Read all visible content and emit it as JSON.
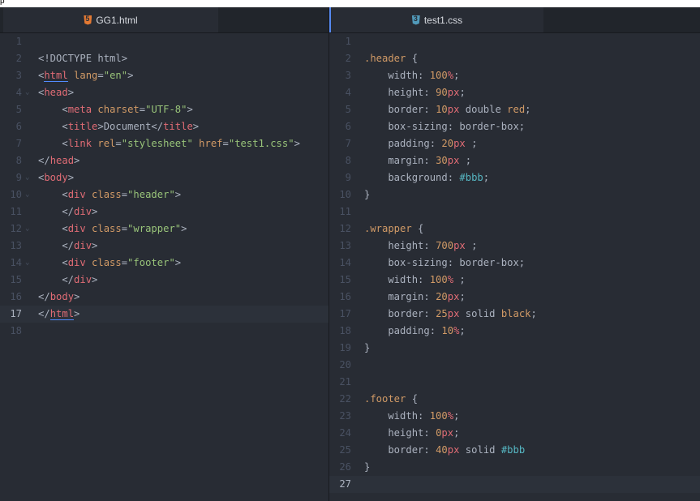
{
  "top_strip": "p",
  "left_tab": {
    "label": "GG1.html",
    "icon": "html5-icon"
  },
  "right_tab": {
    "label": "test1.css",
    "icon": "css3-icon"
  },
  "colors": {
    "background": "#282c34",
    "tab_bar": "#21252b",
    "active_tab_accent": "#568af2",
    "tag": "#e06c75",
    "attribute": "#d19a66",
    "string": "#98c379",
    "number": "#d19a66",
    "unit": "#e06c75",
    "hex": "#56b6c2",
    "line_number": "#495162"
  },
  "html_lines": [
    {
      "n": "1",
      "fold": false,
      "tokens": []
    },
    {
      "n": "2",
      "fold": false,
      "tokens": [
        [
          "punc",
          "<!DOCTYPE html>"
        ]
      ]
    },
    {
      "n": "3",
      "fold": false,
      "tokens": [
        [
          "punc",
          "<"
        ],
        [
          "tag",
          "html"
        ],
        [
          "punc",
          " "
        ],
        [
          "attr",
          "lang"
        ],
        [
          "punc",
          "="
        ],
        [
          "str",
          "\"en\""
        ],
        [
          "punc",
          ">"
        ]
      ]
    },
    {
      "n": "4",
      "fold": true,
      "tokens": [
        [
          "punc",
          "<"
        ],
        [
          "tag",
          "head"
        ],
        [
          "punc",
          ">"
        ]
      ]
    },
    {
      "n": "5",
      "fold": false,
      "tokens": [
        [
          "punc",
          "    <"
        ],
        [
          "tag",
          "meta"
        ],
        [
          "punc",
          " "
        ],
        [
          "attr",
          "charset"
        ],
        [
          "punc",
          "="
        ],
        [
          "str",
          "\"UTF-8\""
        ],
        [
          "punc",
          ">"
        ]
      ]
    },
    {
      "n": "6",
      "fold": false,
      "tokens": [
        [
          "punc",
          "    <"
        ],
        [
          "tag",
          "title"
        ],
        [
          "punc",
          ">Document</"
        ],
        [
          "tag",
          "title"
        ],
        [
          "punc",
          ">"
        ]
      ]
    },
    {
      "n": "7",
      "fold": false,
      "tokens": [
        [
          "punc",
          "    <"
        ],
        [
          "tag",
          "link"
        ],
        [
          "punc",
          " "
        ],
        [
          "attr",
          "rel"
        ],
        [
          "punc",
          "="
        ],
        [
          "str",
          "\"stylesheet\""
        ],
        [
          "punc",
          " "
        ],
        [
          "attr",
          "href"
        ],
        [
          "punc",
          "="
        ],
        [
          "str",
          "\"test1.css\""
        ],
        [
          "punc",
          ">"
        ]
      ]
    },
    {
      "n": "8",
      "fold": false,
      "tokens": [
        [
          "punc",
          "</"
        ],
        [
          "tag",
          "head"
        ],
        [
          "punc",
          ">"
        ]
      ]
    },
    {
      "n": "9",
      "fold": true,
      "tokens": [
        [
          "punc",
          "<"
        ],
        [
          "tag",
          "body"
        ],
        [
          "punc",
          ">"
        ]
      ]
    },
    {
      "n": "10",
      "fold": true,
      "tokens": [
        [
          "punc",
          "    <"
        ],
        [
          "tag",
          "div"
        ],
        [
          "punc",
          " "
        ],
        [
          "attr",
          "class"
        ],
        [
          "punc",
          "="
        ],
        [
          "str",
          "\"header\""
        ],
        [
          "punc",
          ">"
        ]
      ]
    },
    {
      "n": "11",
      "fold": false,
      "tokens": [
        [
          "punc",
          "    </"
        ],
        [
          "tag",
          "div"
        ],
        [
          "punc",
          ">"
        ]
      ]
    },
    {
      "n": "12",
      "fold": true,
      "tokens": [
        [
          "punc",
          "    <"
        ],
        [
          "tag",
          "div"
        ],
        [
          "punc",
          " "
        ],
        [
          "attr",
          "class"
        ],
        [
          "punc",
          "="
        ],
        [
          "str",
          "\"wrapper\""
        ],
        [
          "punc",
          ">"
        ]
      ]
    },
    {
      "n": "13",
      "fold": false,
      "tokens": [
        [
          "punc",
          "    </"
        ],
        [
          "tag",
          "div"
        ],
        [
          "punc",
          ">"
        ]
      ]
    },
    {
      "n": "14",
      "fold": true,
      "tokens": [
        [
          "punc",
          "    <"
        ],
        [
          "tag",
          "div"
        ],
        [
          "punc",
          " "
        ],
        [
          "attr",
          "class"
        ],
        [
          "punc",
          "="
        ],
        [
          "str",
          "\"footer\""
        ],
        [
          "punc",
          ">"
        ]
      ]
    },
    {
      "n": "15",
      "fold": false,
      "tokens": [
        [
          "punc",
          "    </"
        ],
        [
          "tag",
          "div"
        ],
        [
          "punc",
          ">"
        ]
      ]
    },
    {
      "n": "16",
      "fold": false,
      "tokens": [
        [
          "punc",
          "</"
        ],
        [
          "tag",
          "body"
        ],
        [
          "punc",
          ">"
        ]
      ]
    },
    {
      "n": "17",
      "fold": false,
      "cursor": true,
      "tokens": [
        [
          "punc",
          "</"
        ],
        [
          "tag",
          "html"
        ],
        [
          "punc",
          ">"
        ]
      ]
    },
    {
      "n": "18",
      "fold": false,
      "tokens": []
    }
  ],
  "css_lines": [
    {
      "n": "1",
      "tokens": []
    },
    {
      "n": "2",
      "tokens": [
        [
          "sel",
          ".header"
        ],
        [
          "punc",
          " {"
        ]
      ]
    },
    {
      "n": "3",
      "tokens": [
        [
          "prop",
          "    width: "
        ],
        [
          "num",
          "100"
        ],
        [
          "unit",
          "%"
        ],
        [
          "punc",
          ";"
        ]
      ]
    },
    {
      "n": "4",
      "tokens": [
        [
          "prop",
          "    height: "
        ],
        [
          "num",
          "90"
        ],
        [
          "unit",
          "px"
        ],
        [
          "punc",
          ";"
        ]
      ]
    },
    {
      "n": "5",
      "tokens": [
        [
          "prop",
          "    border: "
        ],
        [
          "num",
          "10"
        ],
        [
          "unit",
          "px"
        ],
        [
          "kw",
          " double "
        ],
        [
          "red",
          "red"
        ],
        [
          "punc",
          ";"
        ]
      ]
    },
    {
      "n": "6",
      "tokens": [
        [
          "prop",
          "    box-sizing: "
        ],
        [
          "kw",
          "border-box"
        ],
        [
          "punc",
          ";"
        ]
      ]
    },
    {
      "n": "7",
      "tokens": [
        [
          "prop",
          "    padding: "
        ],
        [
          "num",
          "20"
        ],
        [
          "unit",
          "px"
        ],
        [
          "punc",
          " ;"
        ]
      ]
    },
    {
      "n": "8",
      "tokens": [
        [
          "prop",
          "    margin: "
        ],
        [
          "num",
          "30"
        ],
        [
          "unit",
          "px"
        ],
        [
          "punc",
          " ;"
        ]
      ]
    },
    {
      "n": "9",
      "tokens": [
        [
          "prop",
          "    background: "
        ],
        [
          "hash",
          "#bbb"
        ],
        [
          "punc",
          ";"
        ]
      ]
    },
    {
      "n": "10",
      "tokens": [
        [
          "punc",
          "}"
        ]
      ]
    },
    {
      "n": "11",
      "tokens": []
    },
    {
      "n": "12",
      "tokens": [
        [
          "sel",
          ".wrapper"
        ],
        [
          "punc",
          " {"
        ]
      ]
    },
    {
      "n": "13",
      "tokens": [
        [
          "prop",
          "    height: "
        ],
        [
          "num",
          "700"
        ],
        [
          "unit",
          "px"
        ],
        [
          "punc",
          " ;"
        ]
      ]
    },
    {
      "n": "14",
      "tokens": [
        [
          "prop",
          "    box-sizing: "
        ],
        [
          "kw",
          "border-box"
        ],
        [
          "punc",
          ";"
        ]
      ]
    },
    {
      "n": "15",
      "tokens": [
        [
          "prop",
          "    width: "
        ],
        [
          "num",
          "100"
        ],
        [
          "unit",
          "%"
        ],
        [
          "punc",
          " ;"
        ]
      ]
    },
    {
      "n": "16",
      "tokens": [
        [
          "prop",
          "    margin: "
        ],
        [
          "num",
          "20"
        ],
        [
          "unit",
          "px"
        ],
        [
          "punc",
          ";"
        ]
      ]
    },
    {
      "n": "17",
      "tokens": [
        [
          "prop",
          "    border: "
        ],
        [
          "num",
          "25"
        ],
        [
          "unit",
          "px"
        ],
        [
          "kw",
          " solid "
        ],
        [
          "red",
          "black"
        ],
        [
          "punc",
          ";"
        ]
      ]
    },
    {
      "n": "18",
      "tokens": [
        [
          "prop",
          "    padding: "
        ],
        [
          "num",
          "10"
        ],
        [
          "unit",
          "%"
        ],
        [
          "punc",
          ";"
        ]
      ]
    },
    {
      "n": "19",
      "tokens": [
        [
          "punc",
          "}"
        ]
      ]
    },
    {
      "n": "20",
      "tokens": []
    },
    {
      "n": "21",
      "tokens": []
    },
    {
      "n": "22",
      "tokens": [
        [
          "sel",
          ".footer"
        ],
        [
          "punc",
          " {"
        ]
      ]
    },
    {
      "n": "23",
      "tokens": [
        [
          "prop",
          "    width: "
        ],
        [
          "num",
          "100"
        ],
        [
          "unit",
          "%"
        ],
        [
          "punc",
          ";"
        ]
      ]
    },
    {
      "n": "24",
      "tokens": [
        [
          "prop",
          "    height: "
        ],
        [
          "num",
          "0"
        ],
        [
          "unit",
          "px"
        ],
        [
          "punc",
          ";"
        ]
      ]
    },
    {
      "n": "25",
      "tokens": [
        [
          "prop",
          "    border: "
        ],
        [
          "num",
          "40"
        ],
        [
          "unit",
          "px"
        ],
        [
          "kw",
          " solid "
        ],
        [
          "hash",
          "#bbb"
        ]
      ]
    },
    {
      "n": "26",
      "tokens": [
        [
          "punc",
          "}"
        ]
      ]
    },
    {
      "n": "27",
      "cursor": true,
      "tokens": []
    }
  ]
}
